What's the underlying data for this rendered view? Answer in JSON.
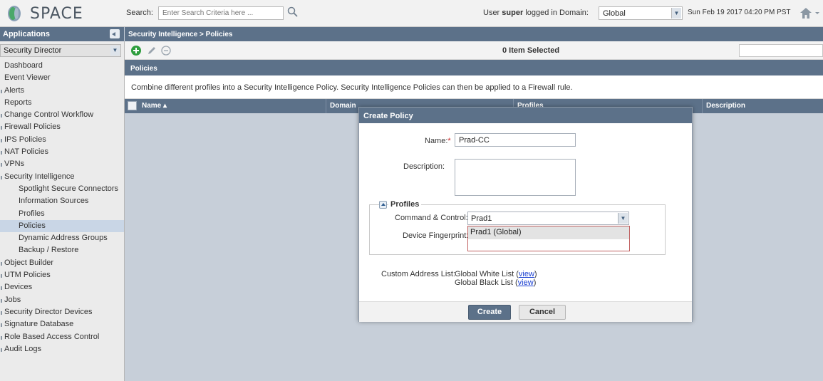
{
  "app": {
    "logo_text": "SPACE"
  },
  "header": {
    "search_label": "Search:",
    "search_placeholder": "Enter Search Criteria here ...",
    "user_prefix": "User ",
    "user_name": "super",
    "user_suffix": " logged in Domain:",
    "domain_value": "Global",
    "datetime": "Sun Feb 19 2017 04:20 PM PST"
  },
  "sidebar": {
    "header": "Applications",
    "app_select": "Security Director",
    "items": [
      {
        "label": "Dashboard",
        "level": 0,
        "folder": false
      },
      {
        "label": "Event Viewer",
        "level": 0,
        "folder": false
      },
      {
        "label": "Alerts",
        "level": 0,
        "folder": true
      },
      {
        "label": "Reports",
        "level": 0,
        "folder": false
      },
      {
        "label": "Change Control Workflow",
        "level": 0,
        "folder": true
      },
      {
        "label": "Firewall Policies",
        "level": 0,
        "folder": true
      },
      {
        "label": "IPS Policies",
        "level": 0,
        "folder": true
      },
      {
        "label": "NAT Policies",
        "level": 0,
        "folder": true
      },
      {
        "label": "VPNs",
        "level": 0,
        "folder": true
      },
      {
        "label": "Security Intelligence",
        "level": 0,
        "folder": true
      },
      {
        "label": "Spotlight Secure Connectors",
        "level": 1,
        "folder": false
      },
      {
        "label": "Information Sources",
        "level": 1,
        "folder": false
      },
      {
        "label": "Profiles",
        "level": 1,
        "folder": false
      },
      {
        "label": "Policies",
        "level": 1,
        "folder": false,
        "selected": true
      },
      {
        "label": "Dynamic Address Groups",
        "level": 1,
        "folder": false
      },
      {
        "label": "Backup / Restore",
        "level": 1,
        "folder": false
      },
      {
        "label": "Object Builder",
        "level": 0,
        "folder": true
      },
      {
        "label": "UTM Policies",
        "level": 0,
        "folder": true
      },
      {
        "label": "Devices",
        "level": 0,
        "folder": true
      },
      {
        "label": "Jobs",
        "level": 0,
        "folder": true
      },
      {
        "label": "Security Director Devices",
        "level": 0,
        "folder": true
      },
      {
        "label": "Signature Database",
        "level": 0,
        "folder": true
      },
      {
        "label": "Role Based Access Control",
        "level": 0,
        "folder": true
      },
      {
        "label": "Audit Logs",
        "level": 0,
        "folder": true
      }
    ]
  },
  "main": {
    "breadcrumb": "Security Intelligence > Policies",
    "selected_count": "0 Item Selected",
    "panel_title": "Policies",
    "panel_description": "Combine different profiles into a Security Intelligence Policy. Security Intelligence Policies can then be applied to a Firewall rule.",
    "columns": [
      "Name ▴",
      "Domain",
      "Profiles",
      "Description"
    ]
  },
  "modal": {
    "title": "Create Policy",
    "name_label": "Name:",
    "name_required": "*",
    "name_value": "Prad-CC",
    "description_label": "Description:",
    "description_value": "",
    "profiles_legend": "Profiles",
    "cc_label": "Command & Control:",
    "cc_value": "Prad1",
    "fingerprint_label": "Device Fingerprint:",
    "dropdown_option": "Prad1 (Global)",
    "custom_address_label": "Custom Address List:",
    "white_list": "Global White List",
    "black_list": "Global Black List",
    "view_link": "view",
    "create_button": "Create",
    "cancel_button": "Cancel"
  },
  "colors": {
    "header_bar": "#5c7189",
    "link": "#1a3fd1",
    "selected_row": "#c9d6e6",
    "add_icon": "#2e9e3e"
  }
}
